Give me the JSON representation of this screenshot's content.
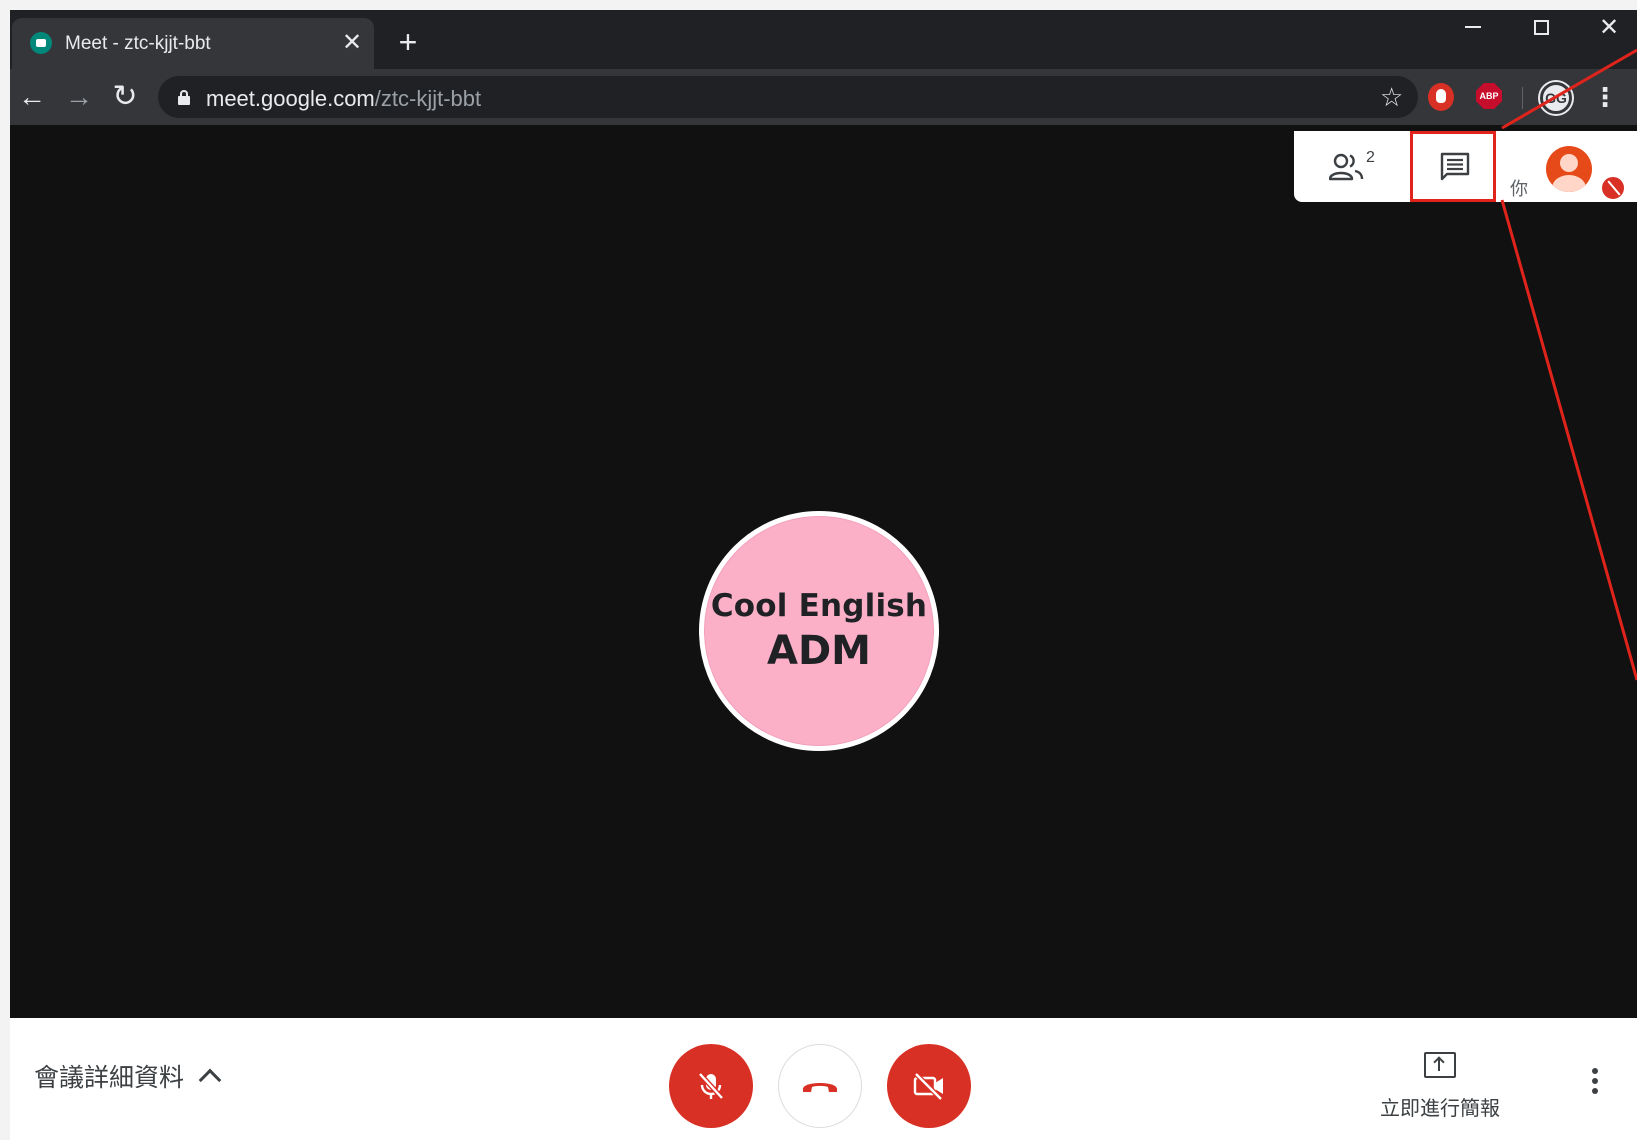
{
  "browser": {
    "tab": {
      "title": "Meet - ztc-kjjt-bbt",
      "close_glyph": "✕",
      "favicon": "google-meet-icon"
    },
    "new_tab_glyph": "+",
    "window_controls": {
      "close_glyph": "✕"
    },
    "address_bar": {
      "host": "meet.google.com",
      "path": "/ztc-kjjt-bbt"
    },
    "nav": {
      "back_glyph": "←",
      "forward_glyph": "→",
      "reload_glyph": "↻"
    },
    "bookmark_glyph": "☆",
    "extensions": {
      "abp_label": "ABP"
    },
    "profile_label": "GG",
    "menu_glyph": "⋮"
  },
  "meet": {
    "participants": {
      "count": "2"
    },
    "self_tile": {
      "label": "你"
    },
    "main_tile": {
      "line1": "Cool English",
      "line2": "ADM"
    },
    "bottom_bar": {
      "meeting_details": "會議詳細資料",
      "present_now": "立即進行簡報"
    }
  },
  "colors": {
    "danger_red": "#d93025",
    "annotation_red": "#e0241b",
    "avatar_pink": "#fbb0c8",
    "stage_bg": "#111111"
  }
}
